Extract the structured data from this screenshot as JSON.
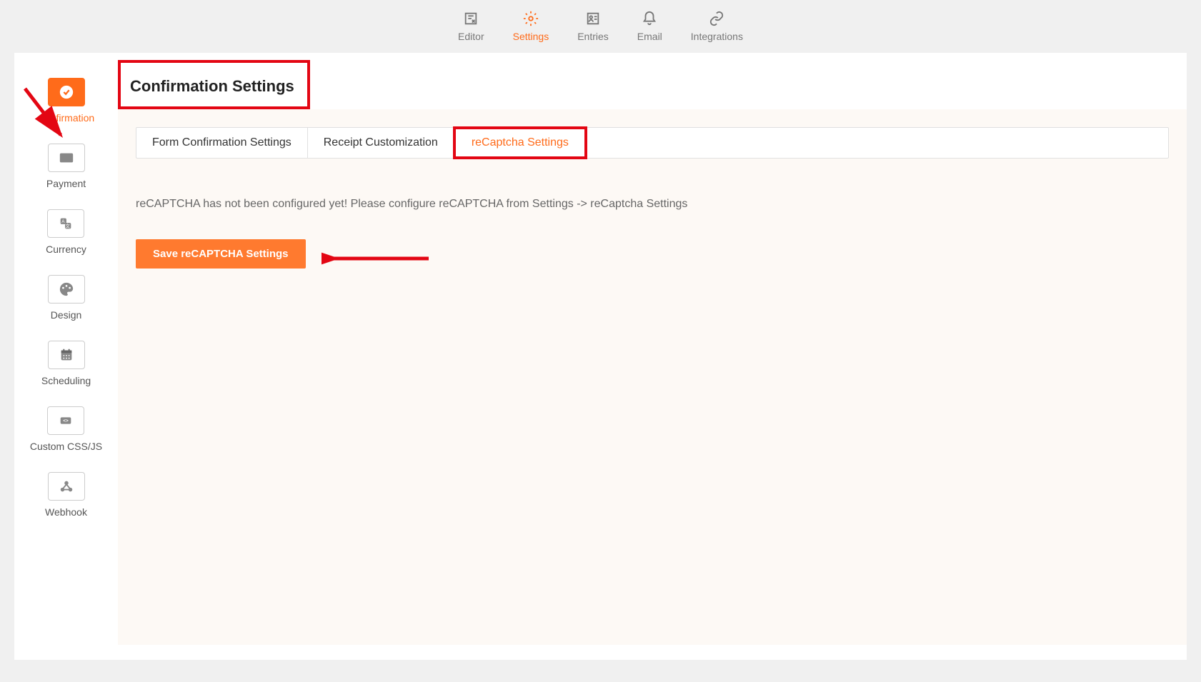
{
  "topNav": {
    "editor": "Editor",
    "settings": "Settings",
    "entries": "Entries",
    "email": "Email",
    "integrations": "Integrations"
  },
  "sidebar": {
    "confirmation": "Confirmation",
    "payment": "Payment",
    "currency": "Currency",
    "design": "Design",
    "scheduling": "Scheduling",
    "customcss": "Custom CSS/JS",
    "webhook": "Webhook"
  },
  "page": {
    "heading": "Confirmation Settings"
  },
  "tabs": {
    "formConfirmation": "Form Confirmation Settings",
    "receipt": "Receipt Customization",
    "recaptcha": "reCaptcha Settings"
  },
  "notice": "reCAPTCHA has not been configured yet! Please configure reCAPTCHA from Settings -> reCaptcha Settings",
  "buttons": {
    "save": "Save reCAPTCHA Settings"
  }
}
